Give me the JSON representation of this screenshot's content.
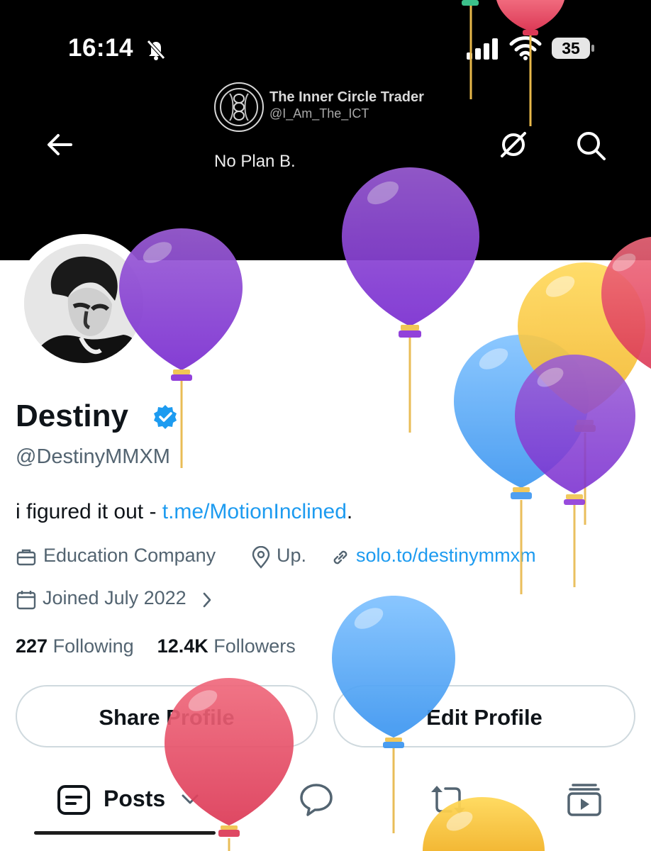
{
  "status_bar": {
    "time": "16:14",
    "battery": "35"
  },
  "banner": {
    "account_name": "The Inner Circle Trader",
    "account_handle": "@I_Am_The_ICT",
    "tagline": "No Plan B."
  },
  "header_icons": {
    "back": "arrow-left-icon",
    "grok": "grok-icon",
    "search": "search-icon"
  },
  "profile": {
    "display_name": "Destiny",
    "handle": "@DestinyMMXM",
    "bio_text": "i figured it out - ",
    "bio_link": "t.me/MotionInclined",
    "bio_end": ".",
    "category": "Education Company",
    "location": "Up.",
    "website": "solo.to/destinymmxm",
    "joined": "Joined July 2022",
    "following_count": "227",
    "following_label": "Following",
    "followers_count": "12.4K",
    "followers_label": "Followers",
    "verified_color": "#1d9bf0"
  },
  "actions": {
    "share_label": "Share Profile",
    "edit_label": "Edit Profile"
  },
  "tabs": {
    "posts_label": "Posts",
    "items": [
      "posts-icon",
      "replies-icon",
      "reposts-icon",
      "media-icon"
    ]
  },
  "colors": {
    "link": "#1d9bf0",
    "text": "#0f1419",
    "secondary": "#536471"
  }
}
